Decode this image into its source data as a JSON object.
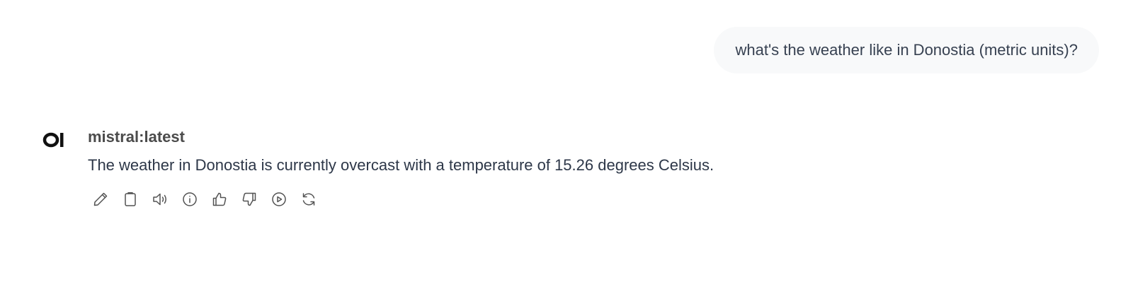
{
  "user_message": {
    "text": "what's the weather like in Donostia (metric units)?"
  },
  "assistant_message": {
    "model_name": "mistral:latest",
    "text": "The weather in Donostia is currently overcast with a temperature of 15.26 degrees Celsius.",
    "actions": [
      {
        "name": "edit",
        "icon": "pencil-icon"
      },
      {
        "name": "copy",
        "icon": "clipboard-icon"
      },
      {
        "name": "read-aloud",
        "icon": "speaker-icon"
      },
      {
        "name": "info",
        "icon": "info-icon"
      },
      {
        "name": "good-response",
        "icon": "thumbs-up-icon"
      },
      {
        "name": "bad-response",
        "icon": "thumbs-down-icon"
      },
      {
        "name": "continue",
        "icon": "play-icon"
      },
      {
        "name": "regenerate",
        "icon": "refresh-icon"
      }
    ]
  },
  "colors": {
    "user_bubble_bg": "#f8f9fa",
    "text": "#2d3748",
    "model_name": "#4b4b4b",
    "icon_stroke": "#525252"
  }
}
